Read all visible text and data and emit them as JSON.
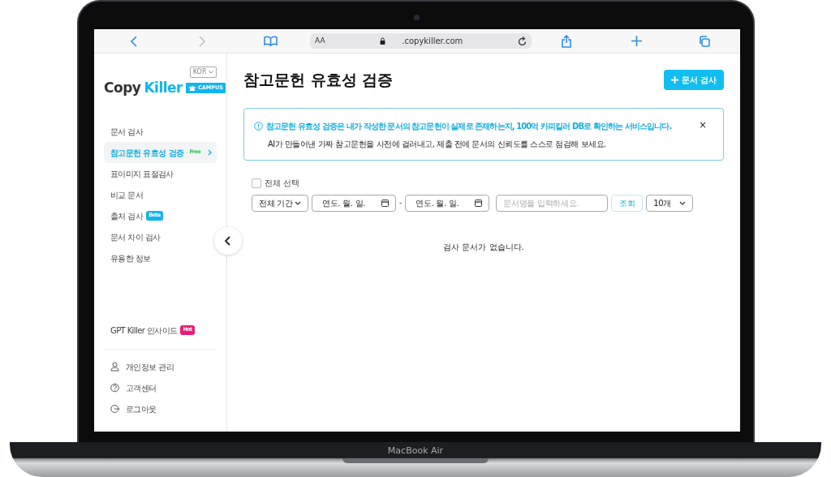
{
  "browser": {
    "text_size": "AA",
    "address": ".copykiller.com"
  },
  "sidebar": {
    "language": "KOR",
    "logo": {
      "first": "Copy",
      "second": "Killer",
      "tag": "CAMPUS"
    },
    "items": [
      {
        "label": "문서 검사",
        "selected": false
      },
      {
        "label": "참고문헌 유효성 검증",
        "badge": {
          "text": "Free",
          "color": "#2fc65a"
        },
        "selected": true
      },
      {
        "label": "표이미지 표절검사",
        "selected": false
      },
      {
        "label": "비교 문서",
        "selected": false
      },
      {
        "label": "출처 검사",
        "badge": {
          "text": "Beta",
          "color": "#12b5f0"
        },
        "selected": false
      },
      {
        "label": "문서 차이 검사",
        "selected": false
      },
      {
        "label": "유용한 정보",
        "selected": false
      }
    ],
    "promo": {
      "label": "GPT Killer 인사이드",
      "badge": {
        "text": "Hot",
        "color": "#ec1c74"
      }
    },
    "account": [
      {
        "kind": "user",
        "label": "개인정보 관리"
      },
      {
        "kind": "help",
        "label": "고객센터"
      },
      {
        "kind": "logout",
        "label": "로그아웃"
      }
    ]
  },
  "main": {
    "title": "참고문헌 유효성 검증",
    "new_button": "문서 검사",
    "notice": {
      "lines": [
        "참고문헌 유효성 검증은 내가 작성한 문서의 참고문헌이 실제로 존재하는지, 100억 카피킬러 DB로 확인하는 서비스입니다.",
        "AI가 만들어낸 가짜 참고문헌을 사전에 걸러내고, 제출 전에 문서의 신뢰도를 스스로 점검해 보세요."
      ],
      "close": "×"
    },
    "select_all": {
      "label": "전체 선택",
      "checked": false
    },
    "filters": {
      "period": "전체 기간",
      "date_from": "연도. 월. 일.",
      "separator": "-",
      "date_to": "연도. 월. 일.",
      "search_placeholder": "문서명을 입력하세요.",
      "search_button": "조회",
      "page_size": "10개"
    },
    "empty_message": "검사 문서가 없습니다."
  },
  "device_label": "MacBook Air"
}
